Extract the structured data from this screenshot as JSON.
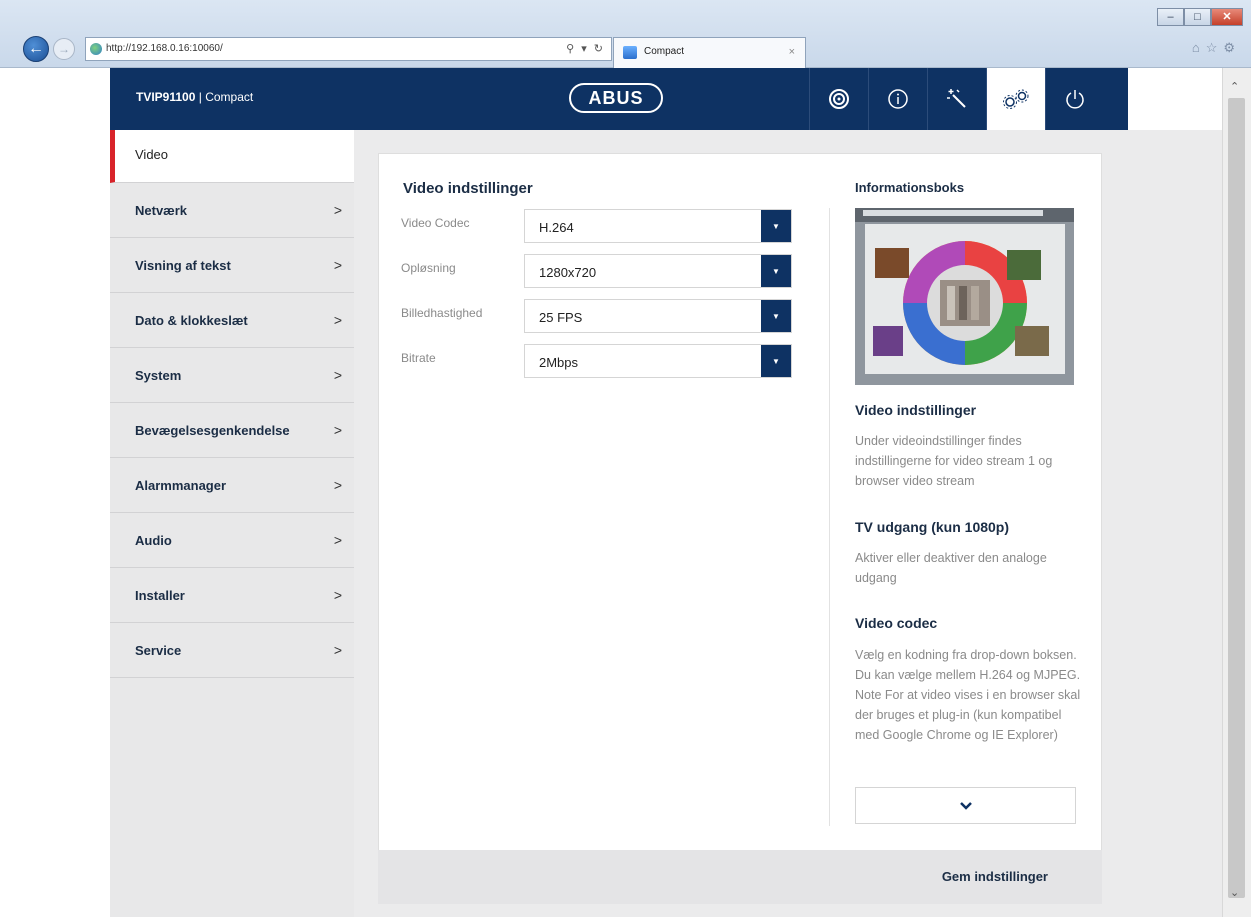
{
  "browser": {
    "url": "http://192.168.0.16:10060/",
    "tab_title": "Compact",
    "window_controls": [
      "minimize",
      "maximize",
      "close"
    ]
  },
  "header": {
    "model": "TVIP91100",
    "separator": " | ",
    "product": "Compact",
    "logo_text": "ABUS",
    "icons": [
      "camera-icon",
      "info-icon",
      "wizard-icon",
      "settings-icon",
      "power-icon"
    ],
    "active_icon": "settings-icon"
  },
  "sidebar": {
    "items": [
      {
        "label": "Video",
        "active": true
      },
      {
        "label": "Netværk",
        "chevron": ">"
      },
      {
        "label": "Visning af tekst",
        "chevron": ">"
      },
      {
        "label": "Dato & klokkeslæt",
        "chevron": ">"
      },
      {
        "label": "System",
        "chevron": ">"
      },
      {
        "label": "Bevægelsesgenkendelse",
        "chevron": ">"
      },
      {
        "label": "Alarmmanager",
        "chevron": ">"
      },
      {
        "label": "Audio",
        "chevron": ">"
      },
      {
        "label": "Installer",
        "chevron": ">"
      },
      {
        "label": "Service",
        "chevron": ">"
      }
    ]
  },
  "main": {
    "title": "Video indstillinger",
    "fields": [
      {
        "label": "Video Codec",
        "value": "H.264"
      },
      {
        "label": "Opløsning",
        "value": "1280x720"
      },
      {
        "label": "Billedhastighed",
        "value": "25 FPS"
      },
      {
        "label": "Bitrate",
        "value": "2Mbps"
      }
    ],
    "save_label": "Gem indstillinger"
  },
  "info": {
    "title": "Informationsboks",
    "sections": [
      {
        "heading": "Video indstillinger",
        "text": "Under videoindstillinger findes indstillingerne for video stream 1 og browser video stream"
      },
      {
        "heading": "TV udgang (kun 1080p)",
        "text": "Aktiver eller deaktiver den analoge udgang"
      },
      {
        "heading": "Video codec",
        "text": "Vælg en kodning fra drop-down boksen. Du kan vælge mellem H.264 og MJPEG. Note For at video vises i en browser skal der bruges et plug-in (kun kompatibel med Google Chrome og IE Explorer)"
      }
    ]
  },
  "colors": {
    "header_bg": "#0e3263",
    "active_marker": "#d8232a",
    "sidebar_bg": "#e8e8e9"
  }
}
